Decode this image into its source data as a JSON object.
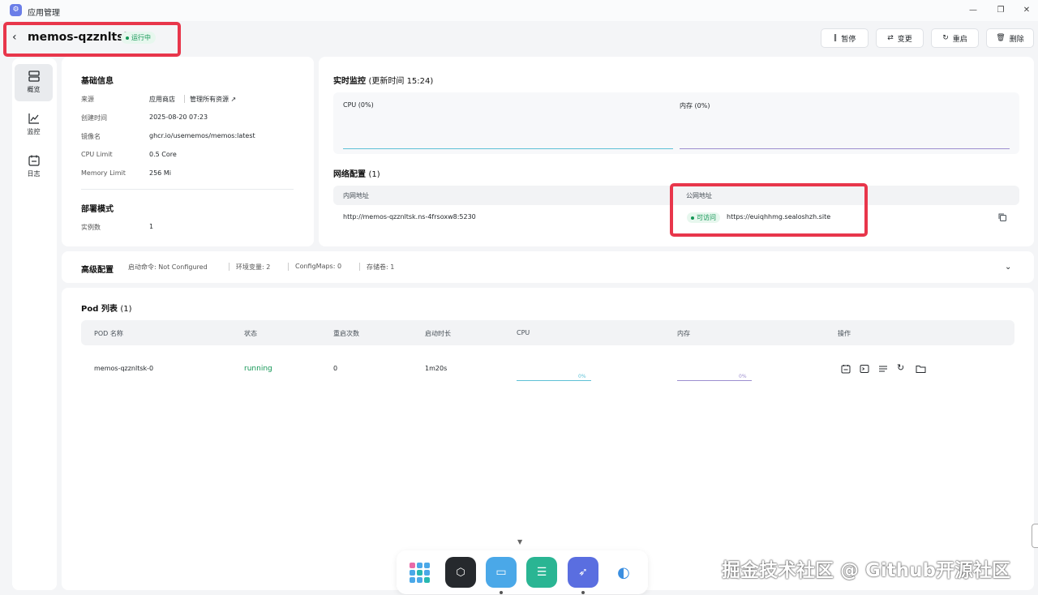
{
  "window": {
    "title": "应用管理"
  },
  "app": {
    "name": "memos-qzznltsk",
    "status": "运行中"
  },
  "toolbar": {
    "pause": "暂停",
    "change": "变更",
    "restart": "重启",
    "delete": "删除"
  },
  "sidebar": {
    "items": [
      {
        "label": "概览"
      },
      {
        "label": "监控"
      },
      {
        "label": "日志"
      }
    ]
  },
  "basic": {
    "title": "基础信息",
    "rows": [
      {
        "label": "来源",
        "value": "应用商店"
      },
      {
        "label": "创建时间",
        "value": "2025-08-20 07:23"
      },
      {
        "label": "镜像名",
        "value": "ghcr.io/usememos/memos:latest"
      },
      {
        "label": "CPU Limit",
        "value": "0.5 Core"
      },
      {
        "label": "Memory Limit",
        "value": "256 Mi"
      }
    ],
    "manage_link": "管理所有资源",
    "deploy_title": "部署模式",
    "instances_label": "实例数",
    "instances_value": "1"
  },
  "monitor": {
    "title": "实时监控",
    "updated": "(更新时间  15:24)",
    "cpu_label": "CPU (0%)",
    "mem_label": "内存 (0%)",
    "cpu_percent": 0,
    "mem_percent": 0
  },
  "network": {
    "title": "网络配置",
    "count": "(1)",
    "internal_header": "内网地址",
    "public_header": "公网地址",
    "internal_value": "http://memos-qzznltsk.ns-4frsoxw8:5230",
    "public_status": "可访问",
    "public_value": "https://euiqhhmg.sealoshzh.site"
  },
  "advanced": {
    "title": "高级配置",
    "items": [
      "启动命令: Not Configured",
      "环境变量: 2",
      "ConfigMaps: 0",
      "存储卷: 1"
    ]
  },
  "pods": {
    "title": "Pod 列表",
    "count": "(1)",
    "headers": [
      "POD 名称",
      "状态",
      "重启次数",
      "启动时长",
      "CPU",
      "内存",
      "操作"
    ],
    "rows": [
      {
        "name": "memos-qzznltsk-0",
        "status": "running",
        "restarts": "0",
        "uptime": "1m20s",
        "cpu": "0%",
        "mem": "0%",
        "cpu_percent": 0,
        "mem_percent": 0
      }
    ]
  },
  "watermark": "掘金技术社区 @ Github开源社区",
  "colors": {
    "accent": "#139655",
    "danger": "#e8364b",
    "cpu_line": "#5ec1d6",
    "mem_line": "#9d8fcf"
  }
}
